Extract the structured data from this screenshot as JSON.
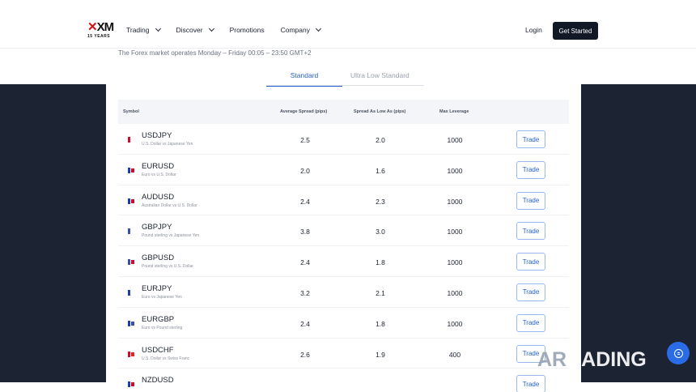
{
  "header": {
    "logo_text": "XM",
    "logo_years": "15 YEARS",
    "nav": [
      "Trading",
      "Discover",
      "Promotions",
      "Company"
    ],
    "login_label": "Login",
    "cta_label": "Get Started"
  },
  "market_note": "The Forex market operates Monday – Friday 00:05 – 23:50 GMT+2",
  "tabs": {
    "active": "Standard",
    "inactive": "Ultra Low Standard"
  },
  "table": {
    "headers": {
      "symbol": "Symbol",
      "avg_spread": "Average Spread (pips)",
      "spread_low": "Spread As Low As (pips)",
      "leverage": "Max Leverage"
    },
    "trade_label": "Trade",
    "rows": [
      {
        "symbol": "USDJPY",
        "desc": "U.S. Dollar vs Japanese Yen",
        "avg": "2.5",
        "low": "2.0",
        "lev": "1000",
        "flag_a": "#c8102e",
        "flag_b": "#ffffff"
      },
      {
        "symbol": "EURUSD",
        "desc": "Euro vs U.S. Dollar",
        "avg": "2.0",
        "low": "1.6",
        "lev": "1000",
        "flag_a": "#1f3fa6",
        "flag_b": "#c8102e"
      },
      {
        "symbol": "AUDUSD",
        "desc": "Australian Dollar vs U.S. Dollar",
        "avg": "2.4",
        "low": "2.3",
        "lev": "1000",
        "flag_a": "#1f3fa6",
        "flag_b": "#c8102e"
      },
      {
        "symbol": "GBPJPY",
        "desc": "Pound sterling vs Japanese Yen",
        "avg": "3.8",
        "low": "3.0",
        "lev": "1000",
        "flag_a": "#3a4fa6",
        "flag_b": "#ffffff"
      },
      {
        "symbol": "GBPUSD",
        "desc": "Pound sterling vs U.S. Dollar",
        "avg": "2.4",
        "low": "1.8",
        "lev": "1000",
        "flag_a": "#3a4fa6",
        "flag_b": "#c8102e"
      },
      {
        "symbol": "EURJPY",
        "desc": "Euro vs Japanese Yen",
        "avg": "3.2",
        "low": "2.1",
        "lev": "1000",
        "flag_a": "#1f3fa6",
        "flag_b": "#ffffff"
      },
      {
        "symbol": "EURGBP",
        "desc": "Euro vs Pound sterling",
        "avg": "2.4",
        "low": "1.8",
        "lev": "1000",
        "flag_a": "#1f3fa6",
        "flag_b": "#3a4fa6"
      },
      {
        "symbol": "USDCHF",
        "desc": "U.S. Dollar vs Swiss Franc",
        "avg": "2.6",
        "low": "1.9",
        "lev": "400",
        "flag_a": "#c8102e",
        "flag_b": "#e0222b"
      },
      {
        "symbol": "NZDUSD",
        "desc": "",
        "avg": "",
        "low": "",
        "lev": "",
        "flag_a": "#1f3fa6",
        "flag_b": "#c8102e"
      }
    ]
  },
  "watermark": {
    "part1": "AR",
    "part2": "RADING"
  },
  "chat_icon": "chat-bubble-icon"
}
